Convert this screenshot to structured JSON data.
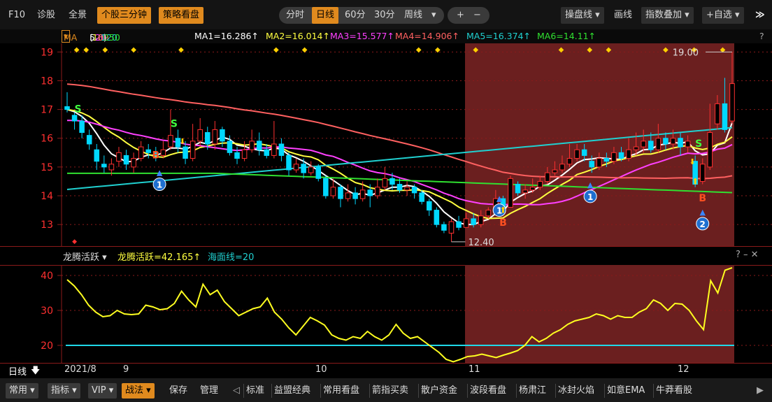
{
  "toolbar": {
    "f10": "F10",
    "diag": "诊股",
    "overview": "全景",
    "three_min": "个股三分钟",
    "strategy": "策略看盘",
    "timeshare": "分时",
    "daily": "日线",
    "m60": "60分",
    "m30": "30分",
    "weekly": "周线",
    "plus": "+",
    "minus": "−",
    "operate_line": "操盘线",
    "draw_line": "画线",
    "index_overlay": "指数叠加",
    "self_select": "+自选",
    "expand": "≫"
  },
  "ma_bar": {
    "label": "MA",
    "params_open": "(",
    "p1": "5",
    "p2": "10",
    "p3": "20",
    "p4": "60",
    "p5": "120",
    "p6": "250",
    "params_close": ")",
    "ma1": "MA1=16.286↑",
    "ma2": "MA2=16.014↑",
    "ma3": "MA3=15.577↑",
    "ma4": "MA4=14.906↑",
    "ma5": "MA5=16.374↑",
    "ma6": "MA6=14.11↑",
    "help": "?"
  },
  "sub_header": {
    "name": "龙腾活跃",
    "value": "龙腾活跃=42.165↑",
    "sea": "海面线=20",
    "controls": "? – ✕"
  },
  "footer": {
    "period": "日线",
    "d0": "2021/8",
    "d1": "9",
    "d2": "10",
    "d3": "11",
    "d4": "12"
  },
  "bottom": {
    "common": "常用",
    "indicator": "指标",
    "vip": "VIP",
    "tactic": "战法",
    "save": "保存",
    "manage": "管理",
    "left_arrow": "◁",
    "tabs": [
      "标准",
      "益盟经典",
      "常用看盘",
      "箭指买卖",
      "散户资金",
      "波段看盘",
      "杨肃江",
      "冰封火焰",
      "如意EMA",
      "牛莽看股"
    ],
    "right_arrow": "▶"
  },
  "chart_data": {
    "type": "candlestick",
    "y_ticks": [
      19,
      18,
      17,
      16,
      15,
      14,
      13
    ],
    "ylim": [
      12.25,
      19.3
    ],
    "annotations": {
      "high": "19.00",
      "low": "12.40"
    },
    "colors": {
      "up": "#ff3030",
      "down": "#00d8ff",
      "ma1": "#ffffff",
      "ma2": "#ffff40",
      "ma3": "#ff40ff",
      "ma4": "#ff6060",
      "ma5": "#20d0d0",
      "ma6": "#30e030",
      "highlight": "#6b1f1f"
    },
    "markers": {
      "sell": "S",
      "buy": "B",
      "circle1": "1",
      "circle2": "2"
    },
    "candles": [
      [
        17.1,
        17.0,
        17.6,
        16.9
      ],
      [
        16.8,
        16.6,
        16.9,
        16.3
      ],
      [
        16.6,
        16.2,
        16.8,
        16.0
      ],
      [
        16.1,
        15.8,
        16.3,
        15.6
      ],
      [
        15.6,
        15.2,
        15.8,
        14.9
      ],
      [
        15.1,
        15.0,
        15.4,
        14.8
      ],
      [
        14.9,
        15.1,
        15.3,
        14.7
      ],
      [
        15.2,
        15.5,
        15.7,
        15.0
      ],
      [
        15.4,
        15.1,
        15.6,
        14.9
      ],
      [
        15.0,
        15.3,
        15.5,
        14.8
      ],
      [
        15.3,
        15.7,
        15.9,
        15.2
      ],
      [
        15.6,
        15.5,
        15.8,
        15.3
      ],
      [
        15.5,
        15.4,
        15.7,
        15.2
      ],
      [
        15.4,
        15.6,
        15.9,
        15.3
      ],
      [
        15.7,
        16.1,
        17.0,
        15.6
      ],
      [
        16.0,
        15.7,
        16.3,
        15.5
      ],
      [
        15.7,
        15.3,
        15.9,
        15.1
      ],
      [
        15.3,
        15.9,
        16.5,
        15.2
      ],
      [
        15.9,
        16.3,
        16.7,
        15.7
      ],
      [
        16.2,
        15.8,
        16.4,
        15.6
      ],
      [
        15.8,
        16.3,
        16.6,
        15.6
      ],
      [
        16.3,
        15.9,
        16.4,
        15.7
      ],
      [
        15.9,
        15.5,
        16.1,
        15.4
      ],
      [
        15.5,
        15.3,
        15.7,
        15.1
      ],
      [
        15.3,
        15.6,
        15.9,
        15.2
      ],
      [
        15.6,
        15.9,
        16.3,
        15.5
      ],
      [
        15.9,
        15.6,
        16.2,
        15.4
      ],
      [
        15.6,
        15.4,
        15.8,
        15.3
      ],
      [
        15.4,
        15.8,
        16.6,
        15.3
      ],
      [
        15.8,
        15.4,
        16.0,
        15.2
      ],
      [
        15.4,
        14.9,
        15.5,
        14.7
      ],
      [
        14.9,
        15.1,
        15.3,
        14.8
      ],
      [
        15.1,
        14.8,
        15.3,
        14.6
      ],
      [
        14.8,
        15.0,
        15.2,
        14.7
      ],
      [
        15.0,
        14.6,
        15.1,
        14.5
      ],
      [
        14.6,
        14.0,
        14.7,
        13.9
      ],
      [
        14.0,
        14.3,
        14.6,
        13.9
      ],
      [
        14.3,
        13.9,
        14.4,
        13.6
      ],
      [
        13.9,
        14.1,
        14.4,
        13.8
      ],
      [
        14.1,
        13.9,
        14.3,
        13.7
      ],
      [
        13.9,
        14.2,
        14.5,
        13.8
      ],
      [
        14.2,
        14.0,
        14.4,
        13.6
      ],
      [
        14.0,
        14.3,
        14.6,
        13.9
      ],
      [
        14.3,
        14.6,
        15.0,
        14.2
      ],
      [
        14.6,
        14.4,
        14.8,
        14.2
      ],
      [
        14.4,
        14.2,
        14.6,
        14.1
      ],
      [
        14.2,
        14.3,
        14.5,
        14.0
      ],
      [
        14.3,
        14.1,
        14.4,
        13.9
      ],
      [
        14.1,
        13.8,
        14.2,
        13.7
      ],
      [
        13.8,
        13.5,
        13.9,
        13.3
      ],
      [
        13.5,
        13.0,
        13.6,
        12.9
      ],
      [
        13.0,
        12.8,
        13.1,
        12.7
      ],
      [
        12.7,
        13.1,
        13.2,
        12.4
      ],
      [
        13.1,
        12.9,
        13.3,
        12.8
      ],
      [
        12.9,
        13.2,
        13.4,
        12.9
      ],
      [
        13.2,
        13.0,
        13.4,
        12.9
      ],
      [
        13.0,
        13.3,
        13.5,
        12.9
      ],
      [
        13.3,
        13.5,
        13.6,
        13.2
      ],
      [
        13.5,
        13.9,
        14.2,
        13.4
      ],
      [
        13.9,
        13.6,
        14.0,
        13.5
      ],
      [
        13.6,
        14.6,
        14.7,
        13.6
      ],
      [
        14.4,
        14.1,
        14.5,
        14.0
      ],
      [
        14.1,
        14.2,
        14.4,
        13.9
      ],
      [
        14.2,
        14.3,
        14.6,
        14.1
      ],
      [
        14.3,
        14.5,
        14.7,
        14.2
      ],
      [
        14.5,
        14.8,
        15.0,
        14.4
      ],
      [
        14.8,
        14.9,
        15.2,
        14.7
      ],
      [
        14.9,
        15.1,
        15.4,
        14.8
      ],
      [
        15.1,
        15.3,
        15.8,
        15.0
      ],
      [
        15.3,
        15.6,
        15.8,
        15.2
      ],
      [
        15.6,
        15.4,
        15.8,
        15.2
      ],
      [
        15.2,
        15.0,
        15.4,
        14.8
      ],
      [
        15.0,
        15.3,
        15.5,
        14.9
      ],
      [
        15.3,
        15.2,
        15.5,
        15.0
      ],
      [
        15.2,
        15.5,
        15.7,
        15.1
      ],
      [
        15.5,
        15.3,
        15.7,
        15.2
      ],
      [
        15.3,
        15.6,
        16.0,
        15.2
      ],
      [
        15.6,
        15.7,
        16.2,
        15.4
      ],
      [
        15.7,
        15.9,
        16.3,
        15.5
      ],
      [
        15.9,
        15.6,
        16.2,
        15.5
      ],
      [
        15.6,
        16.0,
        16.5,
        15.5
      ],
      [
        16.0,
        15.8,
        16.2,
        15.6
      ],
      [
        15.8,
        16.0,
        16.3,
        15.6
      ],
      [
        16.0,
        15.7,
        16.2,
        15.4
      ],
      [
        15.7,
        15.9,
        16.1,
        15.5
      ],
      [
        15.2,
        14.4,
        15.4,
        14.3
      ],
      [
        14.5,
        15.1,
        15.3,
        14.4
      ],
      [
        15.0,
        16.2,
        17.2,
        14.9
      ],
      [
        16.5,
        17.2,
        17.5,
        16.3
      ],
      [
        17.2,
        16.3,
        18.1,
        16.2
      ],
      [
        16.6,
        17.9,
        19.0,
        16.5
      ]
    ],
    "osc": {
      "ylim": [
        15,
        43
      ],
      "y_ticks": [
        40,
        30,
        20
      ],
      "sea_level": 20,
      "values": [
        38.8,
        37.0,
        34.5,
        31.5,
        29.5,
        28.2,
        28.5,
        30.0,
        29.0,
        28.8,
        29.0,
        31.5,
        31.0,
        30.2,
        30.5,
        32.0,
        35.5,
        33.0,
        31.0,
        37.5,
        34.5,
        35.8,
        32.5,
        30.5,
        28.5,
        29.5,
        30.5,
        31.0,
        33.5,
        29.5,
        27.5,
        25.0,
        23.0,
        25.5,
        28.0,
        27.0,
        25.8,
        23.0,
        22.0,
        21.5,
        22.5,
        22.0,
        24.0,
        22.5,
        21.5,
        23.0,
        26.0,
        23.5,
        22.0,
        22.5,
        21.0,
        19.5,
        18.0,
        16.0,
        15.3,
        16.0,
        16.8,
        17.0,
        17.5,
        17.0,
        16.5,
        17.2,
        17.8,
        18.5,
        20.0,
        22.5,
        21.0,
        22.0,
        23.5,
        24.5,
        26.0,
        27.0,
        27.5,
        28.0,
        29.0,
        28.5,
        27.5,
        28.5,
        28.0,
        28.0,
        29.5,
        30.5,
        33.0,
        32.0,
        30.0,
        32.0,
        31.8,
        30.0,
        27.0,
        24.5,
        38.5,
        35.0,
        41.5,
        42.2
      ]
    },
    "dates": {
      "x0": "2021/8",
      "x1": "9",
      "x2": "10",
      "x3": "11",
      "x4": "12"
    }
  }
}
